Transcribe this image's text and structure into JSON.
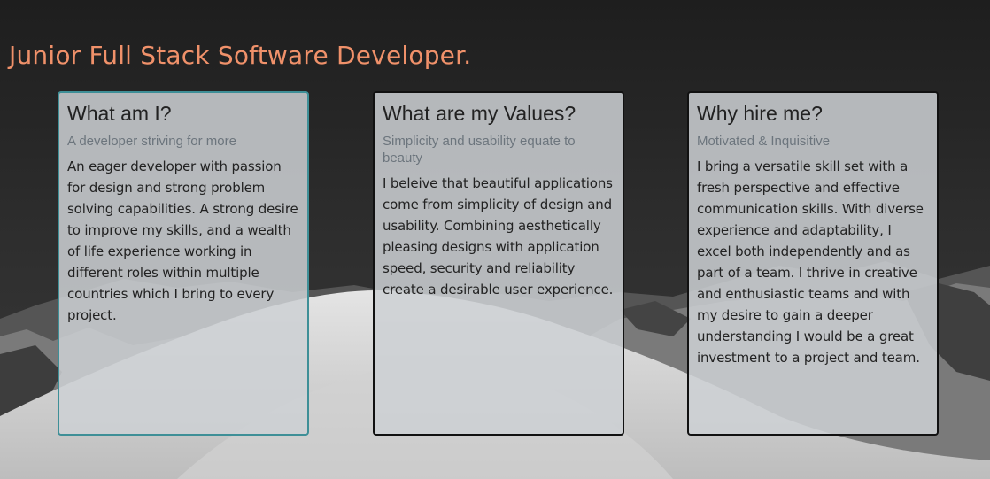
{
  "hero": {
    "title": "Junior Full Stack Software Developer."
  },
  "cards": [
    {
      "title": "What am I?",
      "subtitle": "A developer striving for more",
      "text": "An eager developer with passion for design and strong problem solving capabilities. A strong desire to improve my skills, and a wealth of life experience working in different roles within multiple countries which I bring to every project."
    },
    {
      "title": "What are my Values?",
      "subtitle": "Simplicity and usability equate to beauty",
      "text": "I beleive that beautiful applications come from simplicity of design and usability. Combining aesthetically pleasing designs with application speed, security and reliability create a desirable user experience."
    },
    {
      "title": "Why hire me?",
      "subtitle": "Motivated & Inquisitive",
      "text": "I bring a versatile skill set with a fresh perspective and effective communication skills. With diverse experience and adaptability, I excel both independently and as part of a team. I thrive in creative and enthusiastic teams and with my desire to gain a deeper understanding I would be a great investment to a project and team."
    }
  ],
  "colors": {
    "title_accent": "#f0916a",
    "active_card_border": "#3e8f97",
    "card_border": "#111111",
    "subtitle_text": "#6c757d"
  }
}
